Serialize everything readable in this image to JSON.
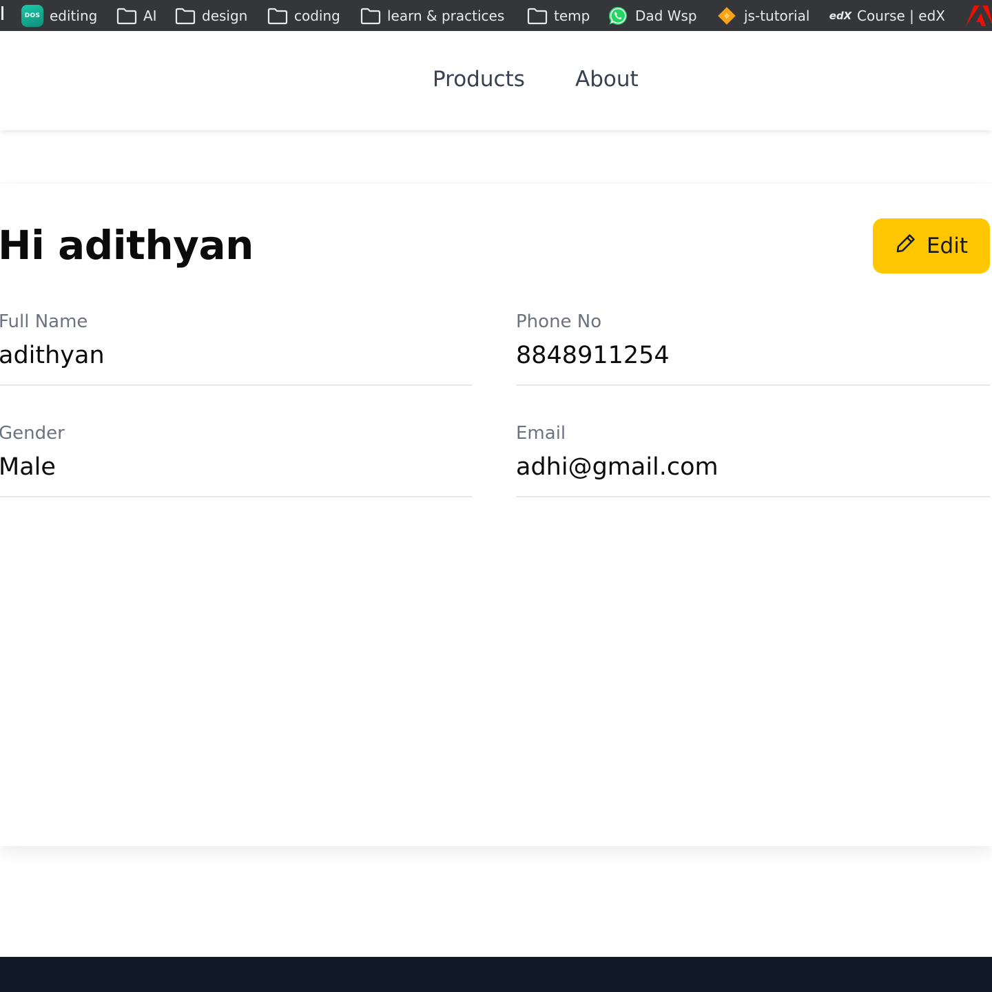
{
  "bookmarks": {
    "items": [
      {
        "label": "editing",
        "icon": "dos-app-icon",
        "icon_text": "DOS"
      },
      {
        "label": "AI",
        "icon": "folder-icon"
      },
      {
        "label": "design",
        "icon": "folder-icon"
      },
      {
        "label": "coding",
        "icon": "folder-icon"
      },
      {
        "label": "learn & practices",
        "icon": "folder-icon"
      },
      {
        "label": "temp",
        "icon": "folder-icon"
      },
      {
        "label": "Dad Wsp",
        "icon": "whatsapp-icon"
      },
      {
        "label": "js-tutorial",
        "icon": "diamond-icon"
      },
      {
        "label": "Course | edX",
        "icon": "edx-icon",
        "icon_text": "edX"
      }
    ],
    "trailing_icon": "adobe-icon"
  },
  "nav": {
    "products": "Products",
    "about": "About"
  },
  "profile": {
    "greeting": "Hi adithyan",
    "edit_label": "Edit",
    "fields": {
      "full_name": {
        "label": "Full Name",
        "value": "adithyan"
      },
      "phone": {
        "label": "Phone No",
        "value": "8848911254"
      },
      "gender": {
        "label": "Gender",
        "value": "Male"
      },
      "email": {
        "label": "Email",
        "value": "adhi@gmail.com"
      }
    }
  },
  "colors": {
    "bookmarks_bg": "#35363a",
    "edit_button": "#fec701",
    "nav_text": "#374151",
    "label_text": "#6b7280",
    "footer_bg": "#111827",
    "whatsapp_green": "#25d366",
    "diamond_orange": "#f7a21b",
    "adobe_red": "#eb1000"
  }
}
